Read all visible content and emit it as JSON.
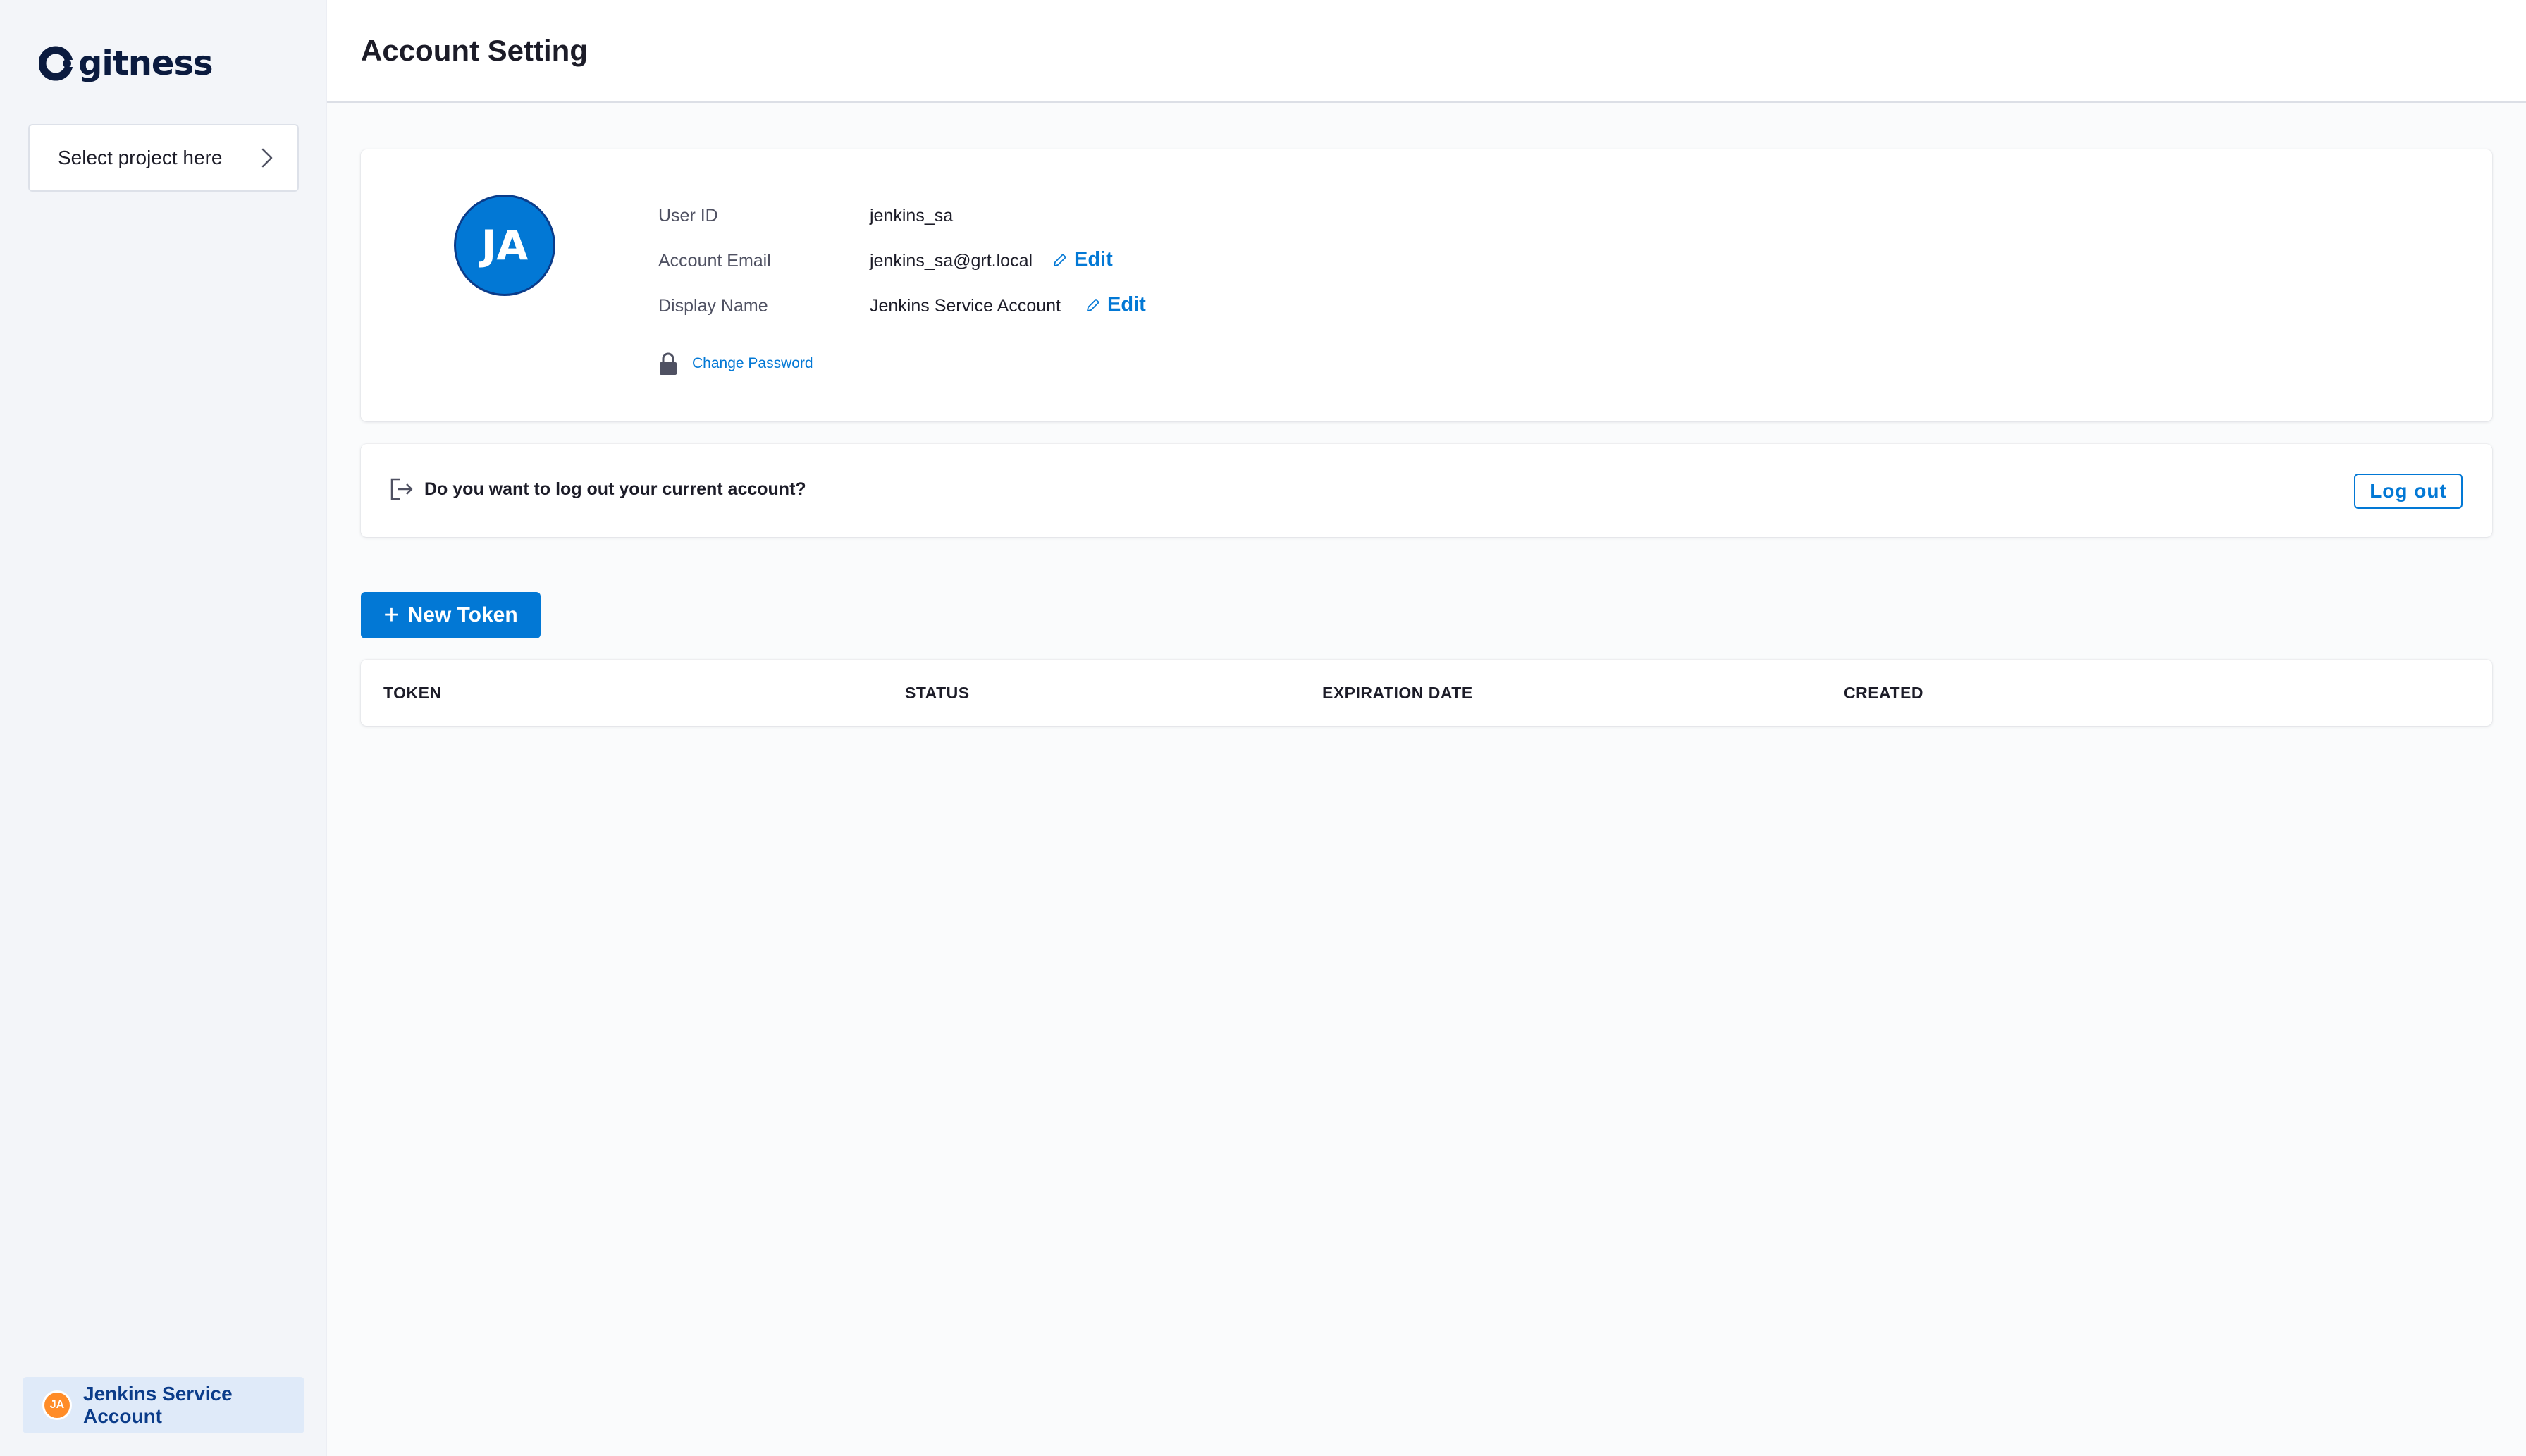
{
  "app": {
    "name": "gitness"
  },
  "sidebar": {
    "project_select_label": "Select project here",
    "user": {
      "initials": "JA",
      "name": "Jenkins Service Account"
    }
  },
  "header": {
    "title": "Account Setting"
  },
  "profile": {
    "initials": "JA",
    "user_id_label": "User ID",
    "user_id": "jenkins_sa",
    "email_label": "Account Email",
    "email": "jenkins_sa@grt.local",
    "display_name_label": "Display Name",
    "display_name": "Jenkins Service Account",
    "edit_label": "Edit",
    "change_password_label": "Change Password"
  },
  "logout": {
    "question": "Do you want to log out your current account?",
    "button_label": "Log out"
  },
  "tokens": {
    "new_token_label": "New Token",
    "columns": [
      "TOKEN",
      "STATUS",
      "EXPIRATION DATE",
      "CREATED"
    ]
  },
  "colors": {
    "primary": "#0278d5",
    "avatar_orange": "#ff8c28",
    "brand_dark": "#0b1b3f"
  }
}
